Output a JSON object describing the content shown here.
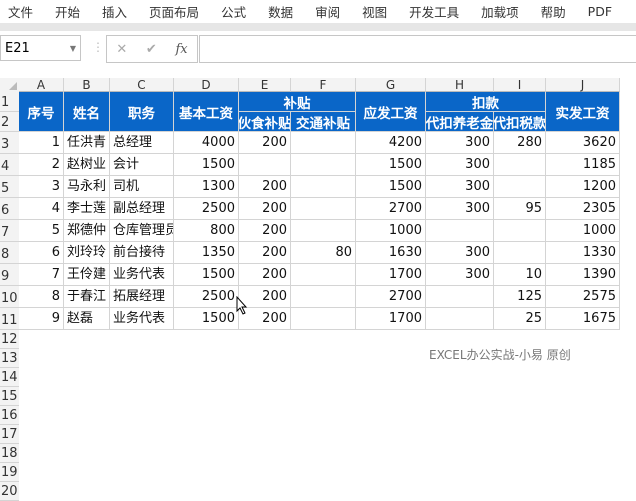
{
  "menu": [
    "文件",
    "开始",
    "插入",
    "页面布局",
    "公式",
    "数据",
    "审阅",
    "视图",
    "开发工具",
    "加载项",
    "帮助",
    "PDF"
  ],
  "formula_bar": {
    "name_box": "E21",
    "cancel": "✕",
    "enter": "✔",
    "fx": "fx",
    "value": ""
  },
  "columns": [
    "A",
    "B",
    "C",
    "D",
    "E",
    "F",
    "G",
    "H",
    "I",
    "J"
  ],
  "header": {
    "seq": "序号",
    "name": "姓名",
    "position": "职务",
    "base": "基本工资",
    "subsidy": "补贴",
    "meal": "伙食补贴",
    "transport": "交通补贴",
    "gross": "应发工资",
    "deduction": "扣款",
    "pension": "代扣养老金",
    "tax": "代扣税款",
    "net": "实发工资"
  },
  "rows": [
    [
      "1",
      "任洪青",
      "总经理",
      "4000",
      "200",
      "",
      "4200",
      "300",
      "280",
      "3620"
    ],
    [
      "2",
      "赵树业",
      "会计",
      "1500",
      "",
      "",
      "1500",
      "300",
      "",
      "1185"
    ],
    [
      "3",
      "马永利",
      "司机",
      "1300",
      "200",
      "",
      "1500",
      "300",
      "",
      "1200"
    ],
    [
      "4",
      "李士莲",
      "副总经理",
      "2500",
      "200",
      "",
      "2700",
      "300",
      "95",
      "2305"
    ],
    [
      "5",
      "郑德仲",
      "仓库管理员",
      "800",
      "200",
      "",
      "1000",
      "",
      "",
      "1000"
    ],
    [
      "6",
      "刘玲玲",
      "前台接待",
      "1350",
      "200",
      "80",
      "1630",
      "300",
      "",
      "1330"
    ],
    [
      "7",
      "王伶建",
      "业务代表",
      "1500",
      "200",
      "",
      "1700",
      "300",
      "10",
      "1390"
    ],
    [
      "8",
      "于春江",
      "拓展经理",
      "2500",
      "200",
      "",
      "2700",
      "",
      "125",
      "2575"
    ],
    [
      "9",
      "赵磊",
      "业务代表",
      "1500",
      "200",
      "",
      "1700",
      "",
      "25",
      "1675"
    ]
  ],
  "row_numbers": [
    "1",
    "2",
    "3",
    "4",
    "5",
    "6",
    "7",
    "8",
    "9",
    "10",
    "11",
    "12",
    "13",
    "14",
    "15",
    "16",
    "17",
    "18",
    "19",
    "20"
  ],
  "watermark": "EXCEL办公实战-小易 原创",
  "colors": {
    "header_bg": "#0a66c8"
  }
}
